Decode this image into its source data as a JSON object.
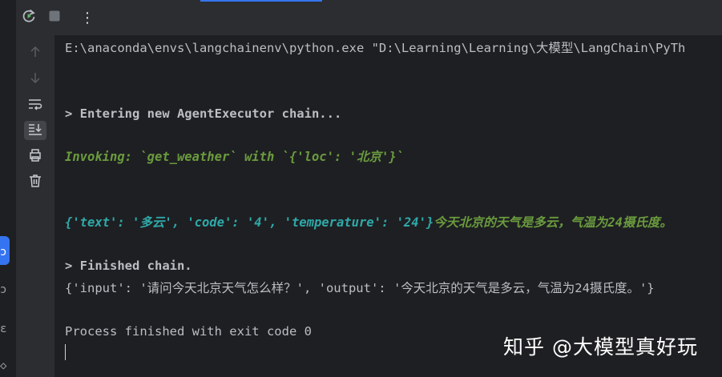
{
  "toolbar": {
    "rerun_icon": "rerun-icon",
    "stop_icon": "stop-icon",
    "more_icon": "more-vertical-icon",
    "more_glyph": "⋮"
  },
  "side_toolbar": {
    "items": [
      {
        "name": "scroll-up-icon"
      },
      {
        "name": "scroll-down-icon"
      },
      {
        "name": "soft-wrap-icon"
      },
      {
        "name": "scroll-to-end-icon"
      },
      {
        "name": "print-icon"
      },
      {
        "name": "trash-icon"
      }
    ]
  },
  "console": {
    "command": "E:\\anaconda\\envs\\langchainenv\\python.exe \"D:\\Learning\\Learning\\大模型\\LangChain\\PyTh",
    "entering": "> Entering new AgentExecutor chain...",
    "invoking": "Invoking: `get_weather` with `{'loc': '北京'}`",
    "tool_result": "{'text': '多云', 'code': '4', 'temperature': '24'}",
    "answer": "今天北京的天气是多云，气温为24摄氏度。",
    "finished": "> Finished chain.",
    "output": "{'input': '请问今天北京天气怎么样？', 'output': '今天北京的天气是多云，气温为24摄氏度。'}",
    "process": "Process finished with exit code 0"
  },
  "colors": {
    "background": "#1e1f22",
    "toolbar": "#2b2d30",
    "text": "#bcbec4",
    "green": "#6a9b3e",
    "teal": "#2fa8a8",
    "accent": "#3574f0"
  },
  "left_strip": {
    "glyph_1": "ɔ",
    "glyph_2": "ɔ",
    "glyph_3": "ɛ",
    "glyph_4": "◇"
  },
  "watermark": "知乎 @大模型真好玩"
}
